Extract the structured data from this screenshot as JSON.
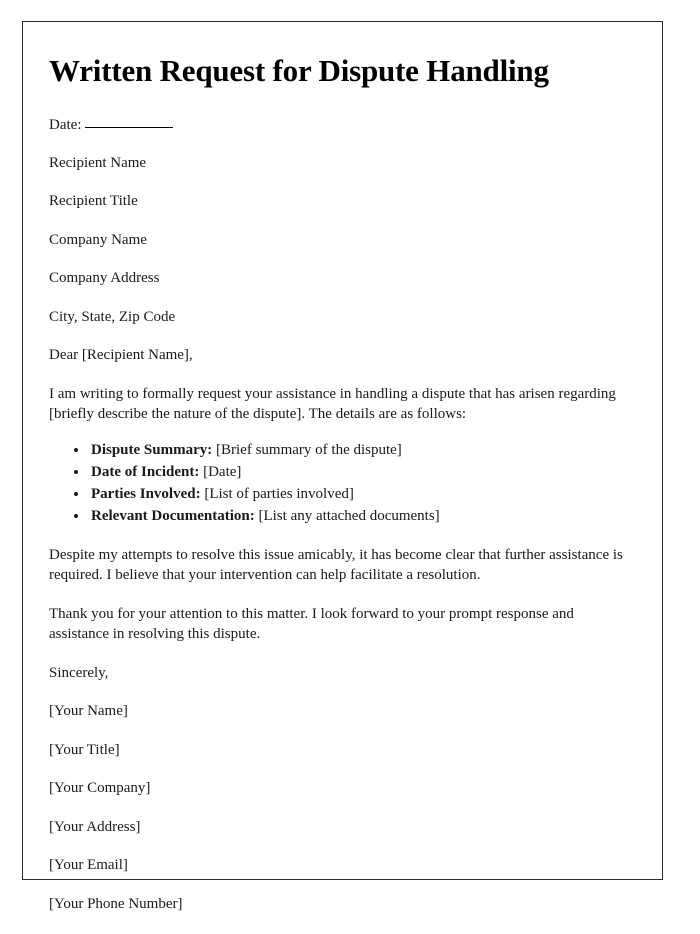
{
  "document": {
    "title": "Written Request for Dispute Handling",
    "date_label": "Date:",
    "date_value": "",
    "recipient_block": [
      "Recipient Name",
      "Recipient Title",
      "Company Name",
      "Company Address",
      "City, State, Zip Code"
    ],
    "salutation": "Dear [Recipient Name],",
    "intro_paragraph": "I am writing to formally request your assistance in handling a dispute that has arisen regarding [briefly describe the nature of the dispute]. The details are as follows:",
    "detail_items": [
      {
        "label": "Dispute Summary:",
        "value": "[Brief summary of the dispute]"
      },
      {
        "label": "Date of Incident:",
        "value": "[Date]"
      },
      {
        "label": "Parties Involved:",
        "value": "[List of parties involved]"
      },
      {
        "label": "Relevant Documentation:",
        "value": "[List any attached documents]"
      }
    ],
    "body_paragraph": "Despite my attempts to resolve this issue amicably, it has become clear that further assistance is required. I believe that your intervention can help facilitate a resolution.",
    "thanks_paragraph": "Thank you for your attention to this matter. I look forward to your prompt response and assistance in resolving this dispute.",
    "closing": "Sincerely,",
    "signature_block": [
      "[Your Name]",
      "[Your Title]",
      "[Your Company]",
      "[Your Address]",
      "[Your Email]",
      "[Your Phone Number]"
    ]
  }
}
